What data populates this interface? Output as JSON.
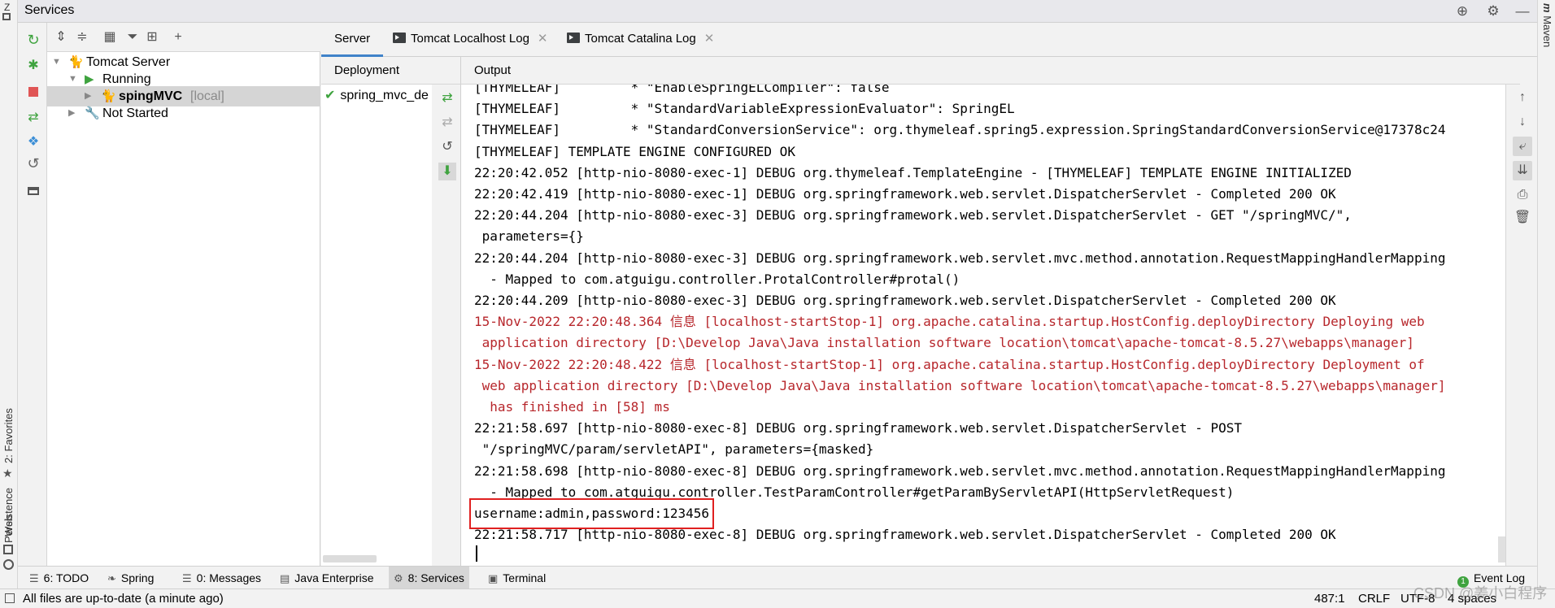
{
  "header": {
    "title": "Services",
    "icons": [
      "crosshair-icon",
      "gear-icon",
      "minimize-icon"
    ]
  },
  "left_stripe": {
    "tabs": [
      {
        "label": "2: Favorites",
        "icon": "star-icon"
      },
      {
        "label": "Persistence",
        "icon": "persistence-icon"
      },
      {
        "label": "Web",
        "icon": "web-icon"
      }
    ],
    "top_tab_label": "Z"
  },
  "right_stripe": {
    "tabs": [
      {
        "label": "Maven"
      }
    ]
  },
  "tree": {
    "nodes": [
      {
        "label": "Tomcat Server",
        "icon": "tomcat-icon"
      },
      {
        "label": "Running",
        "icon": "run-icon"
      },
      {
        "label": "spingMVC",
        "suffix": "[local]",
        "icon": "tomcat-icon"
      },
      {
        "label": "Not Started",
        "icon": "wrench-icon"
      }
    ]
  },
  "tabs": [
    {
      "label": "Server"
    },
    {
      "label": "Tomcat Localhost Log"
    },
    {
      "label": "Tomcat Catalina Log"
    }
  ],
  "deployment": {
    "header": "Deployment",
    "items": [
      {
        "label": "spring_mvc_de"
      }
    ]
  },
  "output": {
    "header": "Output",
    "lines": [
      {
        "text": "[THYMELEAF]         * \"EnableSpringELCompiler\": false",
        "type": "normal"
      },
      {
        "text": "[THYMELEAF]         * \"StandardVariableExpressionEvaluator\": SpringEL",
        "type": "normal"
      },
      {
        "text": "[THYMELEAF]         * \"StandardConversionService\": org.thymeleaf.spring5.expression.SpringStandardConversionService@17378c24",
        "type": "normal"
      },
      {
        "text": "[THYMELEAF] TEMPLATE ENGINE CONFIGURED OK",
        "type": "normal"
      },
      {
        "text": "22:20:42.052 [http-nio-8080-exec-1] DEBUG org.thymeleaf.TemplateEngine - [THYMELEAF] TEMPLATE ENGINE INITIALIZED",
        "type": "normal"
      },
      {
        "text": "22:20:42.419 [http-nio-8080-exec-1] DEBUG org.springframework.web.servlet.DispatcherServlet - Completed 200 OK",
        "type": "normal"
      },
      {
        "text": "22:20:44.204 [http-nio-8080-exec-3] DEBUG org.springframework.web.servlet.DispatcherServlet - GET \"/springMVC/\",",
        "type": "normal"
      },
      {
        "text": " parameters={}",
        "type": "normal"
      },
      {
        "text": "22:20:44.204 [http-nio-8080-exec-3] DEBUG org.springframework.web.servlet.mvc.method.annotation.RequestMappingHandlerMapping",
        "type": "normal"
      },
      {
        "text": "  - Mapped to com.atguigu.controller.ProtalController#protal()",
        "type": "normal"
      },
      {
        "text": "22:20:44.209 [http-nio-8080-exec-3] DEBUG org.springframework.web.servlet.DispatcherServlet - Completed 200 OK",
        "type": "normal"
      },
      {
        "text": "15-Nov-2022 22:20:48.364 信息 [localhost-startStop-1] org.apache.catalina.startup.HostConfig.deployDirectory Deploying web",
        "type": "err"
      },
      {
        "text": " application directory [D:\\Develop Java\\Java installation software location\\tomcat\\apache-tomcat-8.5.27\\webapps\\manager]",
        "type": "err"
      },
      {
        "text": "15-Nov-2022 22:20:48.422 信息 [localhost-startStop-1] org.apache.catalina.startup.HostConfig.deployDirectory Deployment of",
        "type": "err"
      },
      {
        "text": " web application directory [D:\\Develop Java\\Java installation software location\\tomcat\\apache-tomcat-8.5.27\\webapps\\manager]",
        "type": "err"
      },
      {
        "text": "  has finished in [58] ms",
        "type": "err"
      },
      {
        "text": "22:21:58.697 [http-nio-8080-exec-8] DEBUG org.springframework.web.servlet.DispatcherServlet - POST",
        "type": "normal"
      },
      {
        "text": " \"/springMVC/param/servletAPI\", parameters={masked}",
        "type": "normal"
      },
      {
        "text": "22:21:58.698 [http-nio-8080-exec-8] DEBUG org.springframework.web.servlet.mvc.method.annotation.RequestMappingHandlerMapping",
        "type": "normal"
      },
      {
        "text": "  - Mapped to com.atguigu.controller.TestParamController#getParamByServletAPI(HttpServletRequest)",
        "type": "normal"
      },
      {
        "text": "username:admin,password:123456",
        "type": "highlight"
      },
      {
        "text": "22:21:58.717 [http-nio-8080-exec-8] DEBUG org.springframework.web.servlet.DispatcherServlet - Completed 200 OK",
        "type": "normal"
      }
    ]
  },
  "bottom_bar": {
    "tabs": [
      {
        "label": "6: TODO",
        "icon": "list-icon"
      },
      {
        "label": "Spring",
        "icon": "spring-icon"
      },
      {
        "label": "0: Messages",
        "icon": "messages-icon"
      },
      {
        "label": "Java Enterprise",
        "icon": "java-enterprise-icon"
      },
      {
        "label": "8: Services",
        "icon": "services-icon"
      },
      {
        "label": "Terminal",
        "icon": "terminal-icon"
      }
    ],
    "event_log": {
      "label": "Event Log",
      "count": "1"
    }
  },
  "status_bar": {
    "message": "All files are up-to-date (a minute ago)",
    "position": "487:1",
    "line_sep": "CRLF",
    "encoding": "UTF-8",
    "indent": "4 spaces"
  },
  "watermark": "CSDN @姜小白程序",
  "colors": {
    "accent": "#4083c9",
    "error_text": "#b7262b",
    "highlight_box": "#e02020",
    "run_green": "#3fa33f"
  }
}
